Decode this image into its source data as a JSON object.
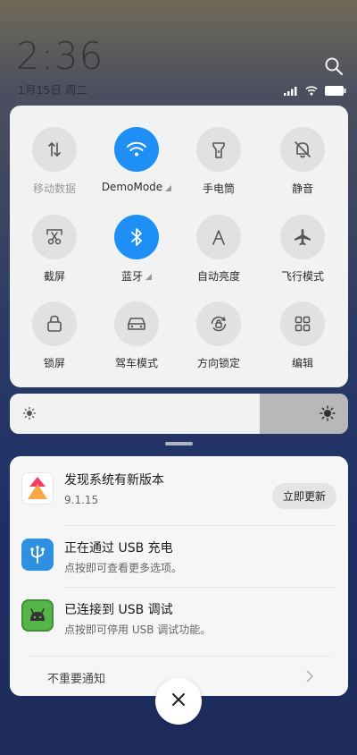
{
  "header": {
    "time": "2:36",
    "date": "1月15日 周二"
  },
  "quick_settings": [
    {
      "label": "移动数据",
      "icon": "mobile-data-icon",
      "active": false,
      "muted": true
    },
    {
      "label": "DemoMode",
      "icon": "wifi-icon",
      "active": true,
      "dropdown": true
    },
    {
      "label": "手电筒",
      "icon": "flashlight-icon",
      "active": false
    },
    {
      "label": "静音",
      "icon": "bell-off-icon",
      "active": false
    },
    {
      "label": "截屏",
      "icon": "screenshot-scissors-icon",
      "active": false
    },
    {
      "label": "蓝牙",
      "icon": "bluetooth-icon",
      "active": true,
      "dropdown": true
    },
    {
      "label": "自动亮度",
      "icon": "auto-brightness-icon",
      "active": false
    },
    {
      "label": "飞行模式",
      "icon": "airplane-icon",
      "active": false
    },
    {
      "label": "锁屏",
      "icon": "lock-icon",
      "active": false
    },
    {
      "label": "驾车模式",
      "icon": "car-icon",
      "active": false
    },
    {
      "label": "方向锁定",
      "icon": "rotation-lock-icon",
      "active": false
    },
    {
      "label": "编辑",
      "icon": "grid-edit-icon",
      "active": false
    }
  ],
  "brightness": {
    "level": 0.74
  },
  "notifications": [
    {
      "title": "发现系统有新版本",
      "subtitle": "9.1.15",
      "icon": "system-update-icon",
      "action": "立即更新"
    },
    {
      "title": "正在通过  USB  充电",
      "subtitle": "点按即可查看更多选项。",
      "icon": "usb-icon"
    },
    {
      "title": "已连接到  USB  调试",
      "subtitle": "点按即可停用 USB 调试功能。",
      "icon": "android-debug-icon"
    }
  ],
  "unimportant_label": "不重要通知",
  "colors": {
    "accent": "#1e90f5",
    "usb_blue": "#2f8fe0",
    "android_green": "#55b548"
  }
}
